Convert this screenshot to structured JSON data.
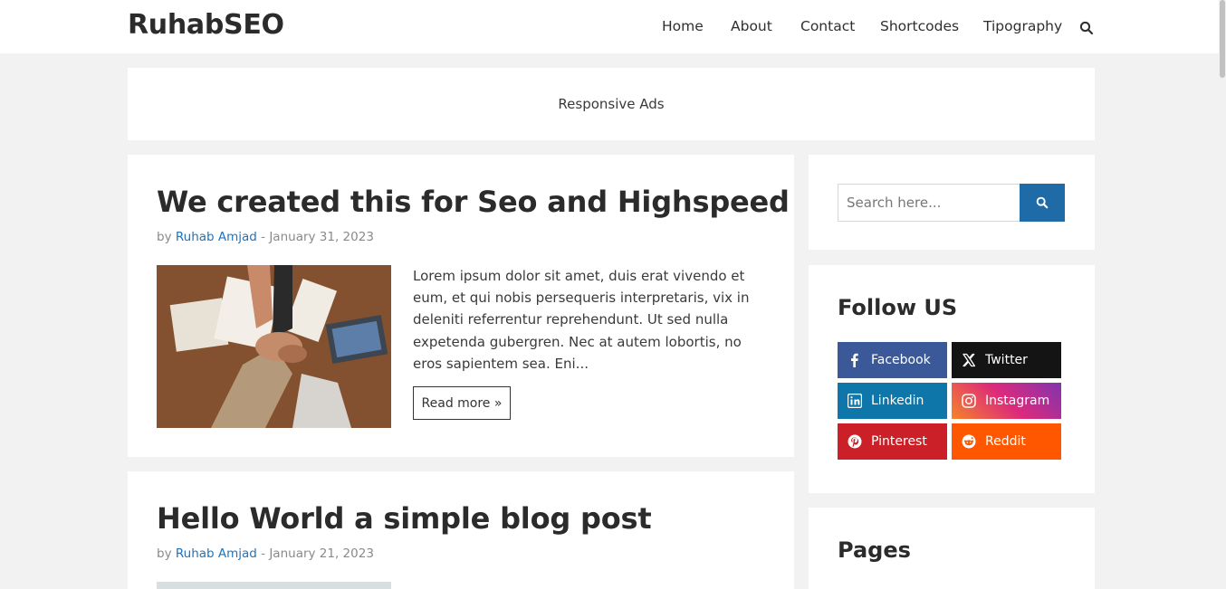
{
  "site": {
    "logo": "RuhabSEO"
  },
  "nav": {
    "items": [
      "Home",
      "About",
      "Contact",
      "Shortcodes",
      "Tipography"
    ]
  },
  "ad": {
    "label": "Responsive Ads"
  },
  "posts": [
    {
      "title": "We created this for Seo and Highspeed",
      "by": "by",
      "author": "Ruhab Amjad",
      "sep": " - ",
      "date": "January 31, 2023",
      "excerpt": "Lorem ipsum dolor sit amet, duis erat vivendo et eum, et qui nobis persequeris interpretaris, vix in deleniti referrentur reprehendunt. Ut sed nulla expetenda gubergren. Nec at autem lobortis, no eros sapientem sea. Eni...",
      "read_more": "Read more »"
    },
    {
      "title": "Hello World a simple blog post",
      "by": "by",
      "author": "Ruhab Amjad",
      "sep": " - ",
      "date": "January 21, 2023"
    }
  ],
  "sidebar": {
    "search": {
      "placeholder": "Search here..."
    },
    "follow": {
      "title": "Follow US",
      "buttons": [
        {
          "label": "Facebook",
          "icon": "facebook-icon",
          "color": "#3b5998"
        },
        {
          "label": "Twitter",
          "icon": "x-twitter-icon",
          "color": "#141414"
        },
        {
          "label": "Linkedin",
          "icon": "linkedin-icon",
          "color": "#0e76a8"
        },
        {
          "label": "Instagram",
          "icon": "instagram-icon",
          "color": "#d62976"
        },
        {
          "label": "Pinterest",
          "icon": "pinterest-icon",
          "color": "#cb2027"
        },
        {
          "label": "Reddit",
          "icon": "reddit-icon",
          "color": "#ff5700"
        }
      ]
    },
    "pages": {
      "title": "Pages"
    }
  }
}
